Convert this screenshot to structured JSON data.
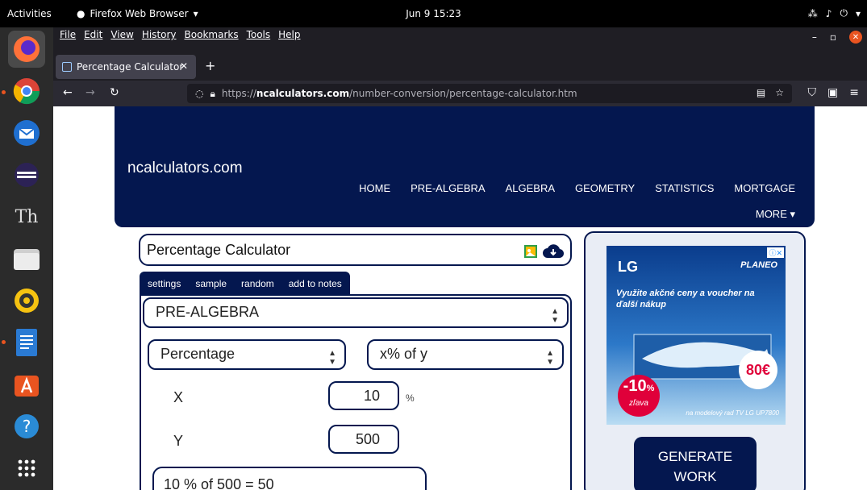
{
  "topbar": {
    "activities": "Activities",
    "app_menu": "Firefox Web Browser",
    "clock": "Jun 9  15:23"
  },
  "menubar": {
    "items": [
      "File",
      "Edit",
      "View",
      "History",
      "Bookmarks",
      "Tools",
      "Help"
    ]
  },
  "tab": {
    "title": "Percentage Calculator"
  },
  "urlbar": {
    "scheme": "https://",
    "host": "ncalculators.com",
    "path": "/number-conversion/percentage-calculator.htm"
  },
  "site": {
    "brand": "ncalculators.com",
    "nav": [
      "HOME",
      "PRE-ALGEBRA",
      "ALGEBRA",
      "GEOMETRY",
      "STATISTICS",
      "MORTGAGE"
    ],
    "more": "MORE ▾"
  },
  "calculator": {
    "title": "Percentage Calculator",
    "tool_tabs": [
      "settings",
      "sample",
      "random",
      "add to notes"
    ],
    "category": "PRE-ALGEBRA",
    "calc_type": "Percentage",
    "formula": "x% of y",
    "x_label": "X",
    "x_value": "10",
    "x_unit": "%",
    "y_label": "Y",
    "y_value": "500",
    "result": "10 % of 500  =  50"
  },
  "ad": {
    "brand": "LG",
    "retailer": "PLANEO",
    "headline": "Využite akčné ceny a voucher na ďalší nákup",
    "discount": "-10",
    "discount_unit": "%",
    "discount_sub": "zľava",
    "voucher": "80€",
    "fine_print": "na modelový rad TV LG UP7800"
  },
  "generate_button": {
    "line1": "GENERATE",
    "line2": "WORK"
  },
  "colors": {
    "brand_navy": "#04174f",
    "ubuntu_orange": "#e95420",
    "dock_bg": "#2b2b2b"
  }
}
